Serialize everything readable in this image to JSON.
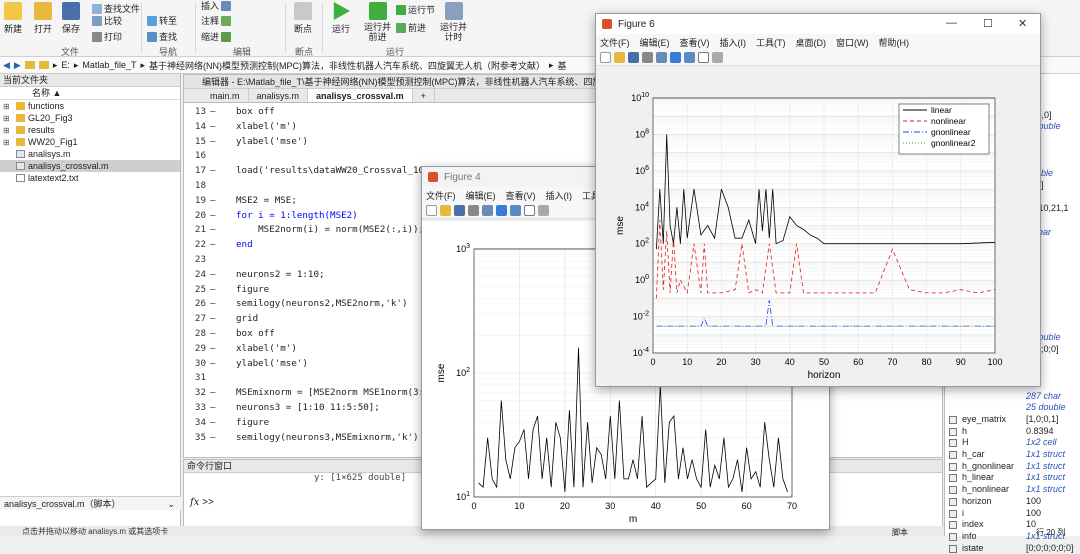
{
  "toolstrip": {
    "big_buttons": [
      {
        "label": "新建",
        "icon": "new-icon"
      },
      {
        "label": "打开",
        "icon": "open-folder-icon"
      },
      {
        "label": "保存",
        "icon": "save-icon"
      }
    ],
    "small_items": [
      "查找文件",
      "比较",
      "打印",
      "转至",
      "查找",
      "注释",
      "缩进"
    ],
    "run_buttons": [
      {
        "label": "断点",
        "icon": "breakpoint-icon"
      },
      {
        "label": "运行",
        "icon": "run-icon"
      },
      {
        "label": "运行并\n前进",
        "icon": "run-advance-icon"
      },
      {
        "label": "运行节",
        "icon": "run-section-icon"
      },
      {
        "label": "前进",
        "icon": "advance-icon"
      },
      {
        "label": "运行并\n计时",
        "icon": "run-time-icon"
      },
      {
        "label": "插入",
        "icon": "insert-icon"
      }
    ],
    "sections": [
      "文件",
      "导航",
      "编辑",
      "断点",
      "运行"
    ]
  },
  "address": {
    "segments": [
      "E:",
      "Matlab_file_T",
      "基于神经网络(NN)模型预测控制(MPC)算法，非线性机器人汽车系统、四旋翼无人机（附参考文献）",
      "基"
    ]
  },
  "file_browser": {
    "title": "当前文件夹",
    "column": "名称 ▲",
    "items": [
      {
        "name": "functions",
        "type": "folder"
      },
      {
        "name": "GL20_Fig3",
        "type": "folder"
      },
      {
        "name": "results",
        "type": "folder"
      },
      {
        "name": "WW20_Fig1",
        "type": "folder"
      },
      {
        "name": "analisys.m",
        "type": "m"
      },
      {
        "name": "analisys_crossval.m",
        "type": "m",
        "selected": true
      },
      {
        "name": "latextext2.txt",
        "type": "txt"
      }
    ],
    "details_label": "analisys_crossval.m（脚本）"
  },
  "editor": {
    "title": "编辑器 - E:\\Matlab_file_T\\基于神经网络(NN)模型预测控制(MPC)算法，非线性机器人汽车系统、四旋",
    "tabs": [
      "main.m",
      "analisys.m",
      "analisys_crossval.m",
      "+"
    ],
    "lines": [
      {
        "n": "13",
        "dash": "—",
        "code": "box off"
      },
      {
        "n": "14",
        "dash": "—",
        "code": "xlabel('m')"
      },
      {
        "n": "15",
        "dash": "—",
        "code": "ylabel('mse')"
      },
      {
        "n": "16",
        "dash": "",
        "code": ""
      },
      {
        "n": "17",
        "dash": "—",
        "code": "load('results\\dataWW20_Crossval_10\\("
      },
      {
        "n": "18",
        "dash": "",
        "code": ""
      },
      {
        "n": "19",
        "dash": "—",
        "code": "MSE2 = MSE;"
      },
      {
        "n": "20",
        "dash": "—",
        "code": "for i = 1:length(MSE2)"
      },
      {
        "n": "21",
        "dash": "—",
        "code": "    MSE2norm(i) = norm(MSE2(:,i));"
      },
      {
        "n": "22",
        "dash": "—",
        "code": "end"
      },
      {
        "n": "23",
        "dash": "",
        "code": ""
      },
      {
        "n": "24",
        "dash": "—",
        "code": "neurons2 = 1:10;"
      },
      {
        "n": "25",
        "dash": "—",
        "code": "figure"
      },
      {
        "n": "26",
        "dash": "—",
        "code": "semilogy(neurons2,MSE2norm,'k')"
      },
      {
        "n": "27",
        "dash": "—",
        "code": "grid"
      },
      {
        "n": "28",
        "dash": "—",
        "code": "box off"
      },
      {
        "n": "29",
        "dash": "—",
        "code": "xlabel('m')"
      },
      {
        "n": "30",
        "dash": "—",
        "code": "ylabel('mse')"
      },
      {
        "n": "31",
        "dash": "",
        "code": ""
      },
      {
        "n": "32",
        "dash": "—",
        "code": "MSEmixnorm = [MSE2norm MSE1norm(3:en"
      },
      {
        "n": "33",
        "dash": "—",
        "code": "neurons3 = [1:10 11:5:50];"
      },
      {
        "n": "34",
        "dash": "—",
        "code": "figure"
      },
      {
        "n": "35",
        "dash": "—",
        "code": "semilogy(neurons3,MSEmixnorm,'k')"
      }
    ]
  },
  "command_window": {
    "title": "命令行窗口",
    "output": "y: [1×625 double]",
    "prompt": ">>"
  },
  "workspace": {
    "rows": [
      {
        "name": "",
        "value": "000",
        "italic": false
      },
      {
        "name": "",
        "value": "-1;0,0]",
        "italic": false
      },
      {
        "name": "",
        "value": "5 double",
        "italic": true
      },
      {
        "name": "",
        "value": "",
        "italic": false
      },
      {
        "name": "",
        "value": ";0]",
        "italic": false
      },
      {
        "name": "",
        "value": "]",
        "italic": false
      },
      {
        "name": "",
        "value": "double",
        "italic": true
      },
      {
        "name": "",
        "value": ";0,1]",
        "italic": false
      },
      {
        "name": "",
        "value": "000",
        "italic": false
      },
      {
        "name": "",
        "value": "21,10,21,1",
        "italic": false
      },
      {
        "name": "",
        "value": "",
        "italic": false
      },
      {
        "name": "",
        "value": "1 char",
        "italic": true
      },
      {
        "name": "",
        "value": "",
        "italic": false
      },
      {
        "name": "",
        "value": "",
        "italic": false
      },
      {
        "name": "",
        "value": "",
        "italic": false
      },
      {
        "name": "",
        "value": "000",
        "italic": false
      },
      {
        "name": "",
        "value": "",
        "italic": false
      },
      {
        "name": "",
        "value": "",
        "italic": false
      },
      {
        "name": "",
        "value": "",
        "italic": false
      },
      {
        "name": "",
        "value": "",
        "italic": false
      },
      {
        "name": "",
        "value": "1 double",
        "italic": true
      },
      {
        "name": "",
        "value": ";0;0;0;0]",
        "italic": false
      },
      {
        "name": "",
        "value": "",
        "italic": false
      },
      {
        "name": "",
        "value": "",
        "italic": false
      },
      {
        "name": "",
        "value": "100",
        "italic": false
      },
      {
        "name": "",
        "value": "287 char",
        "italic": true
      },
      {
        "name": "",
        "value": "25 double",
        "italic": true
      },
      {
        "name": "eye_matrix",
        "value": "[1,0;0,1]",
        "italic": false
      },
      {
        "name": "h",
        "value": "0.8394",
        "italic": false
      },
      {
        "name": "H",
        "value": "1x2 cell",
        "italic": true
      },
      {
        "name": "h_car",
        "value": "1x1 struct",
        "italic": true
      },
      {
        "name": "h_gnonlinear",
        "value": "1x1 struct",
        "italic": true
      },
      {
        "name": "h_linear",
        "value": "1x1 struct",
        "italic": true
      },
      {
        "name": "h_nonlinear",
        "value": "1x1 struct",
        "italic": true
      },
      {
        "name": "horizon",
        "value": "100",
        "italic": false
      },
      {
        "name": "i",
        "value": "100",
        "italic": false
      },
      {
        "name": "index",
        "value": "10",
        "italic": false
      },
      {
        "name": "info",
        "value": "1x1 struct",
        "italic": true
      },
      {
        "name": "istate",
        "value": "[0;0;0;0;0;0]",
        "italic": false
      }
    ],
    "footer": "脚本",
    "footer_right": "行 20  列"
  },
  "status": {
    "text": "点击并拖动以移动 analisys.m 或其选项卡"
  },
  "figure4": {
    "title": "Figure 4",
    "menu": [
      "文件(F)",
      "编辑(E)",
      "查看(V)",
      "插入(I)",
      "工具"
    ],
    "icons": [
      "new-icon",
      "open-icon",
      "save-icon",
      "print-icon",
      "zoom-icon",
      "colorbar-icon",
      "legend-icon",
      "pointer-icon",
      "panel-icon"
    ]
  },
  "figure6": {
    "title": "Figure 6",
    "menu": [
      "文件(F)",
      "编辑(E)",
      "查看(V)",
      "插入(I)",
      "工具(T)",
      "桌面(D)",
      "窗口(W)",
      "帮助(H)"
    ],
    "icons": [
      "new-icon",
      "open-icon",
      "save-icon",
      "print-icon",
      "zoom-icon",
      "colorbar-icon",
      "legend-icon",
      "pointer-icon",
      "panel-icon"
    ]
  },
  "chart_data": [
    {
      "type": "line",
      "title": "",
      "xlabel": "m",
      "ylabel": "mse",
      "yscale": "log",
      "xlim": [
        0,
        70
      ],
      "ylim": [
        10,
        1000
      ],
      "xticks": [
        0,
        10,
        20,
        30,
        40,
        50,
        60,
        70
      ],
      "yticks": [
        "10^1",
        "10^2",
        "10^3"
      ],
      "grid": true,
      "series": [
        {
          "color": "#000000",
          "x": [
            1,
            2,
            3,
            4,
            5,
            6,
            7,
            8,
            9,
            10,
            11,
            12,
            13,
            14,
            15,
            16,
            17,
            18,
            19,
            20,
            21,
            22,
            23,
            24,
            25,
            26,
            27,
            28,
            29,
            30,
            31,
            32,
            33,
            34,
            35,
            36,
            37,
            38,
            39,
            40,
            41,
            42,
            43,
            44,
            45,
            46,
            47,
            48,
            49,
            50,
            51,
            52,
            53,
            54,
            55,
            56,
            57,
            58,
            59,
            60,
            61,
            62,
            63,
            64,
            65,
            66,
            67,
            68,
            69
          ],
          "y": [
            13,
            12,
            30,
            14,
            12,
            60,
            20,
            14,
            25,
            28,
            35,
            14,
            35,
            45,
            14,
            30,
            12,
            40,
            30,
            11,
            50,
            12,
            160,
            12,
            40,
            13,
            25,
            22,
            14,
            45,
            14,
            60,
            14,
            14,
            20,
            14,
            45,
            12,
            13,
            14,
            80,
            13,
            40,
            45,
            14,
            25,
            14,
            20,
            14,
            12,
            35,
            12,
            18,
            14,
            30,
            12,
            14,
            20,
            11,
            25,
            14,
            16,
            12,
            40,
            20,
            12,
            30,
            14,
            11
          ]
        }
      ]
    },
    {
      "type": "line",
      "title": "",
      "xlabel": "horizon",
      "ylabel": "mse",
      "yscale": "log",
      "xlim": [
        0,
        100
      ],
      "ylim": [
        0.0001,
        10000000000
      ],
      "xticks": [
        0,
        10,
        20,
        30,
        40,
        50,
        60,
        70,
        80,
        90,
        100
      ],
      "yticks": [
        "10^-4",
        "10^-2",
        "10^0",
        "10^2",
        "10^4",
        "10^6",
        "10^8",
        "10^10"
      ],
      "grid": true,
      "legend_position": "top-right",
      "series": [
        {
          "name": "linear",
          "color": "#000000",
          "dash": "",
          "x": [
            1,
            2,
            3,
            4,
            5,
            6,
            7,
            8,
            9,
            10,
            12,
            14,
            16,
            18,
            20,
            22,
            24,
            26,
            28,
            30,
            31,
            32,
            33,
            34,
            35,
            36,
            38,
            40,
            42,
            44,
            46,
            48,
            50,
            60,
            70,
            80,
            90,
            100
          ],
          "y": [
            50,
            100000,
            100,
            100000000,
            1000,
            100,
            10000,
            100,
            100000,
            200,
            100000,
            300,
            1000,
            200,
            100000,
            10000,
            200,
            200,
            2000,
            100,
            100000,
            500,
            100000,
            200,
            100000,
            100,
            150,
            3000,
            1000,
            600,
            300,
            200,
            100,
            100,
            100,
            100,
            100,
            120
          ]
        },
        {
          "name": "nonlinear",
          "color": "#e41a1c",
          "dash": "4,3",
          "x": [
            1,
            2,
            3,
            4,
            5,
            6,
            7,
            8,
            10,
            12,
            14,
            15,
            16,
            18,
            20,
            24,
            26,
            28,
            30,
            32,
            34,
            36,
            38,
            40,
            42,
            44,
            46,
            50,
            55,
            60,
            65,
            70,
            75,
            80,
            85,
            90,
            95,
            100
          ],
          "y": [
            0.1,
            2000,
            0.3,
            500,
            0.2,
            200,
            0.2,
            1,
            0.2,
            100,
            0.2,
            100,
            0.2,
            0.2,
            0.2,
            0.3,
            100,
            0.2,
            0.3,
            0.2,
            100,
            0.2,
            0.2,
            0.2,
            100,
            0.2,
            0.2,
            0.2,
            0.2,
            0.2,
            0.2,
            50,
            0.3,
            0.2,
            0.2,
            0.3,
            0.2,
            0.3
          ]
        },
        {
          "name": "gnonlinear",
          "color": "#1f3cff",
          "dash": "6,2,1,2",
          "x": [
            1,
            5,
            10,
            14,
            15,
            16,
            20,
            25,
            30,
            33,
            34,
            35,
            40,
            50,
            60,
            70,
            80,
            90,
            100
          ],
          "y": [
            0.003,
            0.003,
            0.003,
            0.003,
            0.008,
            0.003,
            0.003,
            0.003,
            0.003,
            0.003,
            0.08,
            0.003,
            0.003,
            0.003,
            0.003,
            0.003,
            0.003,
            0.003,
            0.003
          ]
        },
        {
          "name": "gnonlinear2",
          "color": "#33a02c",
          "dash": "1,2",
          "x": [
            1,
            100
          ],
          "y": [
            0.003,
            0.003
          ]
        }
      ]
    }
  ]
}
